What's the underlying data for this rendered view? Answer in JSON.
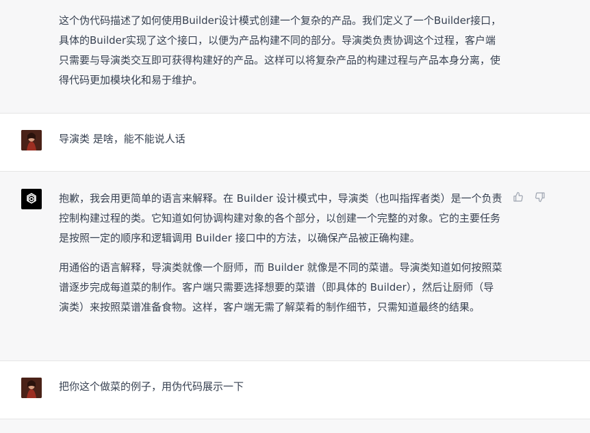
{
  "conversation": {
    "messages": [
      {
        "role": "assistant",
        "paragraphs": [
          "这个伪代码描述了如何使用Builder设计模式创建一个复杂的产品。我们定义了一个Builder接口，具体的Builder实现了这个接口，以便为产品构建不同的部分。导演类负责协调这个过程，客户端只需要与导演类交互即可获得构建好的产品。这样可以将复杂产品的构建过程与产品本身分离，使得代码更加模块化和易于维护。"
        ]
      },
      {
        "role": "user",
        "text": "导演类 是啥，能不能说人话"
      },
      {
        "role": "assistant",
        "paragraphs": [
          "抱歉，我会用更简单的语言来解释。在 Builder 设计模式中，导演类（也叫指挥者类）是一个负责控制构建过程的类。它知道如何协调构建对象的各个部分，以创建一个完整的对象。它的主要任务是按照一定的顺序和逻辑调用 Builder 接口中的方法，以确保产品被正确构建。",
          "用通俗的语言解释，导演类就像一个厨师，而 Builder 就像是不同的菜谱。导演类知道如何按照菜谱逐步完成每道菜的制作。客户端只需要选择想要的菜谱（即具体的 Builder），然后让厨师（导演类）来按照菜谱准备食物。这样，客户端无需了解菜肴的制作细节，只需知道最终的结果。"
        ]
      },
      {
        "role": "user",
        "text": "把你这个做菜的例子，用伪代码展示一下"
      }
    ]
  },
  "icons": {
    "assistant_avatar": "openai-logo-icon",
    "user_avatar": "user-photo-avatar",
    "thumbs_up": "thumbs-up-icon",
    "thumbs_down": "thumbs-down-icon"
  },
  "colors": {
    "assistant_bg": "#f7f7f8",
    "user_bg": "#ffffff",
    "text": "#374151",
    "divider": "#e5e5e5"
  }
}
